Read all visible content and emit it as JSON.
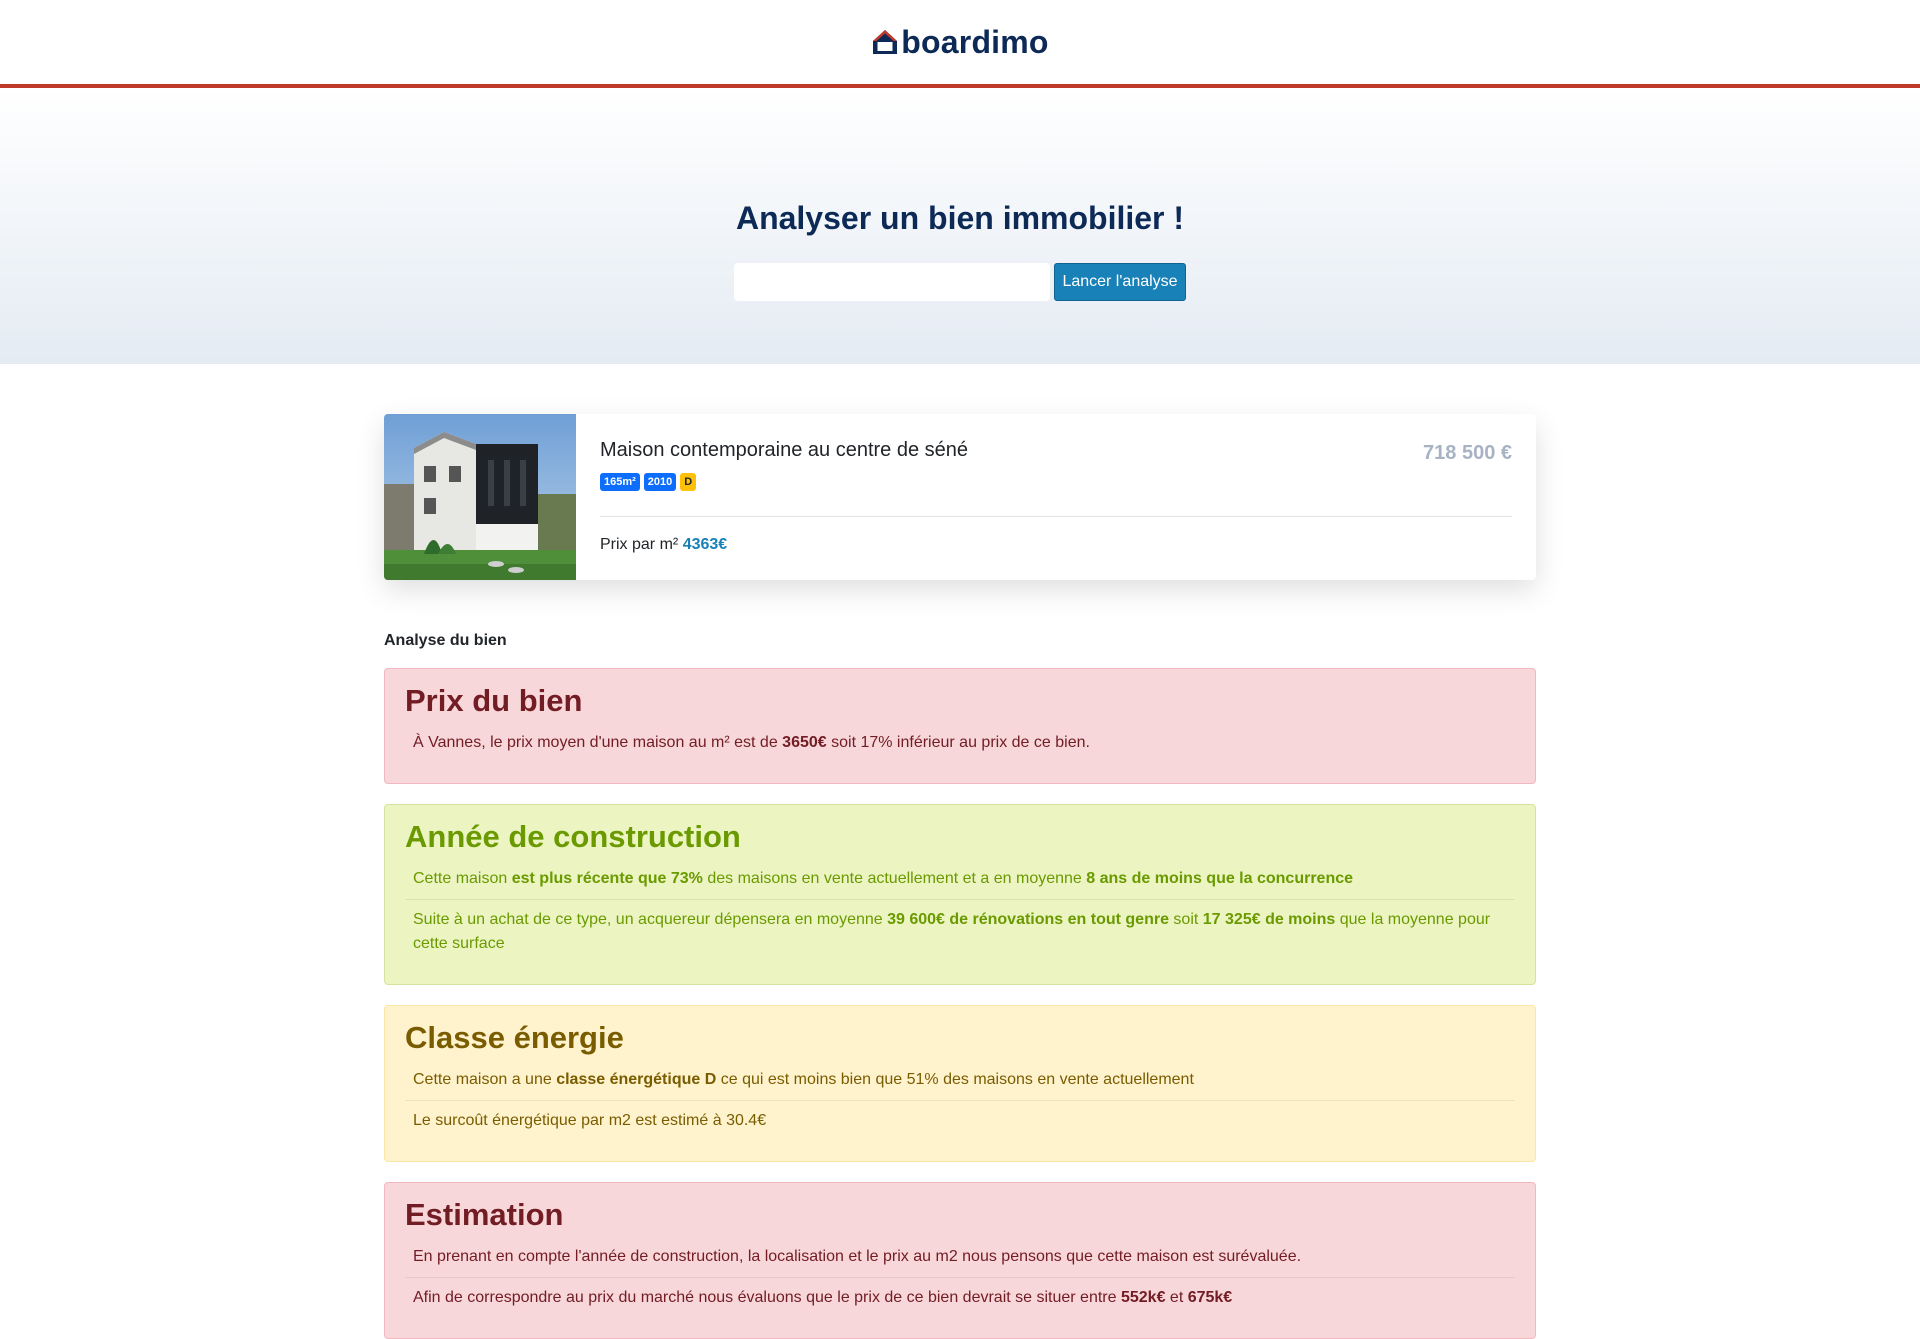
{
  "brand": {
    "name": "boardimo"
  },
  "hero": {
    "title": "Analyser un bien immobilier !",
    "search_value": "",
    "button_label": "Lancer l'analyse"
  },
  "property": {
    "title": "Maison contemporaine au centre de séné",
    "price": "718 500 €",
    "badges": {
      "surface": "165m²",
      "year": "2010",
      "energy": "D"
    },
    "price_per_m2_label": "Prix par m²",
    "price_per_m2_value": "4363€",
    "photo_icon": "house-photo"
  },
  "analysis": {
    "label": "Analyse du bien",
    "prix": {
      "title": "Prix du bien",
      "l1a": "À Vannes, le prix moyen d'une maison au m² est de ",
      "l1b": "3650€",
      "l1c": " soit 17% inférieur au prix de ce bien."
    },
    "annee": {
      "title": "Année de construction",
      "l1a": "Cette maison ",
      "l1b": "est plus récente que 73%",
      "l1c": " des maisons en vente actuellement et a en moyenne ",
      "l1d": "8 ans de moins que la concurrence",
      "l2a": "Suite à un achat de ce type, un acquereur dépensera en moyenne ",
      "l2b": "39 600€ de rénovations en tout genre",
      "l2c": " soit ",
      "l2d": "17 325€ de moins",
      "l2e": " que la moyenne pour cette surface"
    },
    "energie": {
      "title": "Classe énergie",
      "l1a": "Cette maison a une ",
      "l1b": "classe énergétique D",
      "l1c": " ce qui est moins bien que 51% des maisons en vente actuellement",
      "l2": "Le surcoût énergétique par m2 est estimé à 30.4€"
    },
    "estimation": {
      "title": "Estimation",
      "l1": "En prenant en compte l'année de construction, la localisation et le prix au m2 nous pensons que cette maison est surévaluée.",
      "l2a": "Afin de correspondre au prix du marché nous évaluons que le prix de ce bien devrait se situer entre ",
      "l2b": "552k€",
      "l2c": " et ",
      "l2d": "675k€"
    }
  },
  "colors": {
    "brand_navy": "#0d2a57",
    "brand_red": "#c0392b",
    "button_blue": "#1781b8",
    "danger_bg": "#f8d7da",
    "success_bg": "#ecf4c2",
    "warning_bg": "#fff3cd"
  }
}
